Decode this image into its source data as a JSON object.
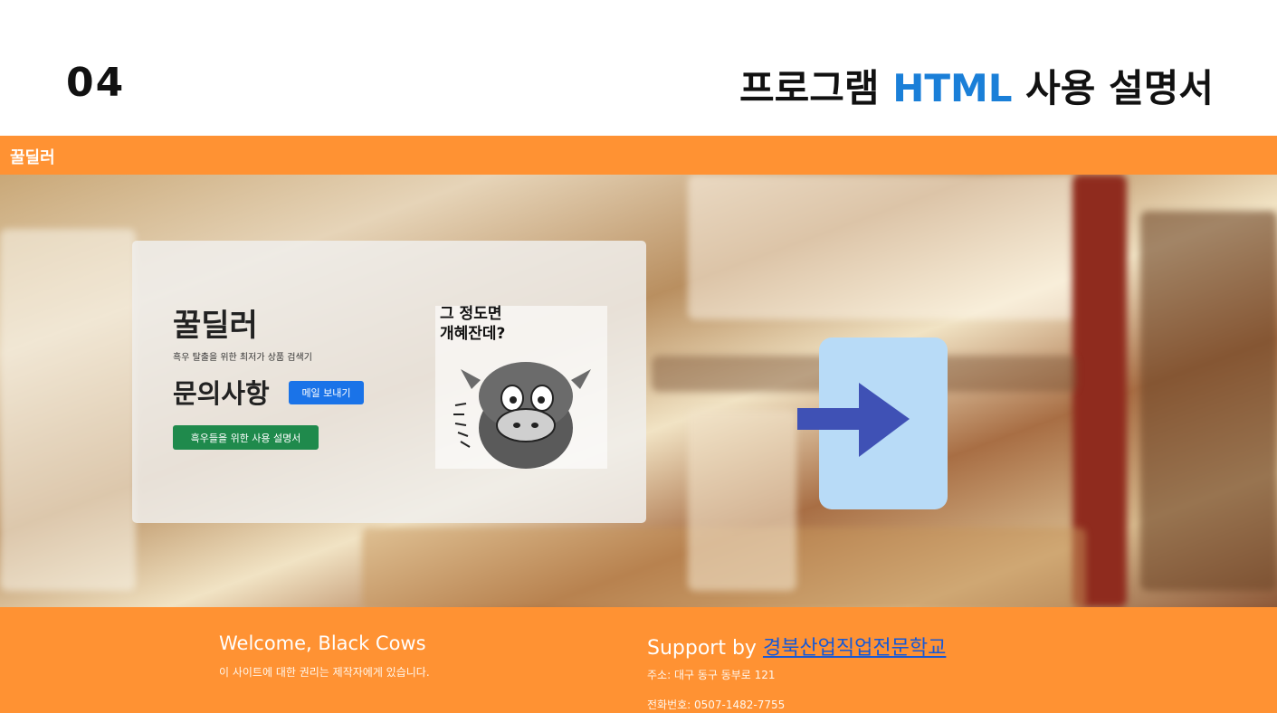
{
  "slide": {
    "number": "04",
    "title_prefix": "프로그램",
    "title_accent": "HTML",
    "title_suffix": "사용 설명서"
  },
  "navbar": {
    "brand": "꿀딜러"
  },
  "card": {
    "title": "꿀딜러",
    "subtitle": "흑우 탈출을 위한 최저가 상품 검색기",
    "inquiry_title": "문의사항",
    "mail_button": "메일 보내기",
    "manual_button": "흑우들을 위한 사용 설명서",
    "cow_caption_line1": "그 정도면",
    "cow_caption_line2": "개혜잔데?"
  },
  "arrow_icon": "right-arrow-icon",
  "footer": {
    "welcome": "Welcome, Black Cows",
    "rights": "이 사이트에 대한 권리는 제작자에게 있습니다.",
    "support_prefix": "Support by",
    "support_link": "경북산업직업전문학교",
    "address": "주소: 대구 동구 동부로 121",
    "phone": "전화번호: 0507-1482-7755"
  },
  "colors": {
    "brand_orange": "#ff9233",
    "accent_blue": "#1a7fd8",
    "mail_button": "#1a73e8",
    "manual_button": "#1f8a4c",
    "arrow_bg": "#b8dbf7",
    "arrow": "#3f51b5"
  }
}
